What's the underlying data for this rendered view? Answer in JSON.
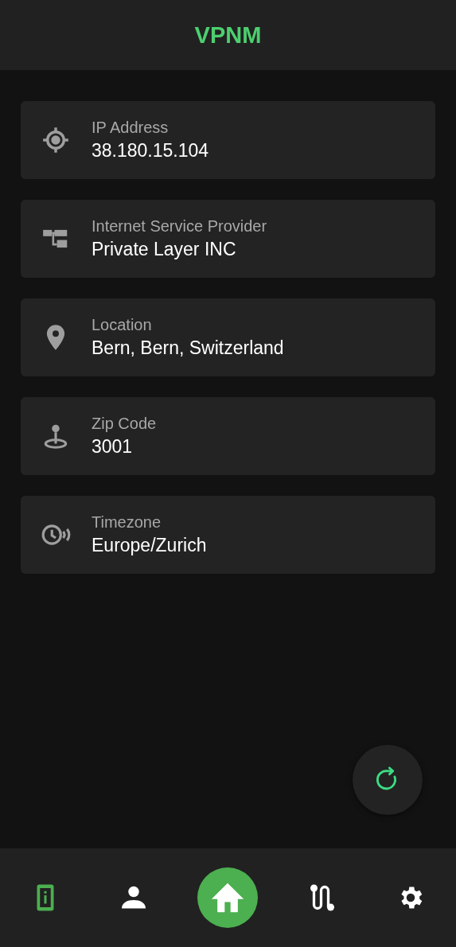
{
  "app_bar": {
    "title": "VPNM"
  },
  "info_cards": [
    {
      "kind": "ip",
      "label": "IP Address",
      "value": "38.180.15.104"
    },
    {
      "kind": "isp",
      "label": "Internet Service Provider",
      "value": "Private Layer INC"
    },
    {
      "kind": "location",
      "label": "Location",
      "value": "Bern, Bern, Switzerland"
    },
    {
      "kind": "zip",
      "label": "Zip Code",
      "value": "3001"
    },
    {
      "kind": "timezone",
      "label": "Timezone",
      "value": "Europe/Zurich"
    }
  ],
  "bottom_nav": [
    {
      "kind": "info",
      "selected": true
    },
    {
      "kind": "account",
      "selected": false
    },
    {
      "kind": "home",
      "selected": false
    },
    {
      "kind": "route",
      "selected": false
    },
    {
      "kind": "settings",
      "selected": false
    }
  ]
}
